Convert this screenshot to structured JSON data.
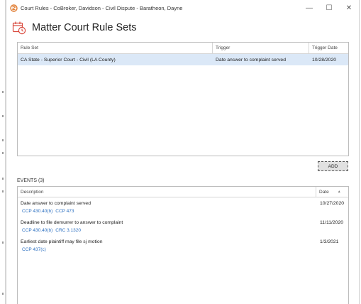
{
  "window": {
    "title": "Court Rules - CoBroker, Davidson - Civil Dispute - Baratheon, Dayne",
    "minimize_glyph": "—",
    "maximize_glyph": "☐",
    "close_glyph": "✕"
  },
  "header": {
    "title": "Matter Court Rule Sets"
  },
  "rule_sets": {
    "columns": [
      "Rule Set",
      "Trigger",
      "Trigger Date"
    ],
    "rows": [
      {
        "rule_set": "CA State - Superior Court - Civil (LA County)",
        "trigger": "Date answer to complaint served",
        "trigger_date": "10/28/2020"
      }
    ]
  },
  "add_button": {
    "label": "ADD"
  },
  "events": {
    "label": "EVENTS (3)",
    "columns": [
      "Description",
      "Date"
    ],
    "sort_glyph": "▲",
    "items": [
      {
        "description": "Date answer to complaint served",
        "refs": [
          "CCP 430.40(b)",
          "CCP 473"
        ],
        "date": "10/27/2020"
      },
      {
        "description": "Deadline to file demurrer to answer to complaint",
        "refs": [
          "CCP 430.40(b)",
          "CRC 3.1320"
        ],
        "date": "11/11/2020"
      },
      {
        "description": "Earliest date plaintiff may file sj motion",
        "refs": [
          "CCP 437(c)"
        ],
        "date": "1/3/2021"
      }
    ]
  },
  "colors": {
    "accent": "#d9473b",
    "link": "#2b6fc0",
    "selected_row": "#dbe8f7"
  }
}
